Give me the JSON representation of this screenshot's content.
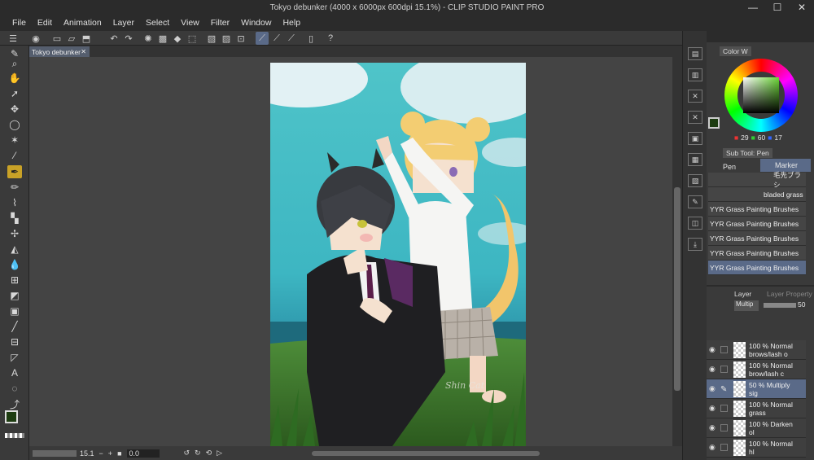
{
  "window": {
    "title": "Tokyo debunker (4000 x 6000px 600dpi 15.1%)  - CLIP STUDIO PAINT PRO",
    "minimize": "—",
    "maximize": "☐",
    "close": "✕"
  },
  "menu": [
    "File",
    "Edit",
    "Animation",
    "Layer",
    "Select",
    "View",
    "Filter",
    "Window",
    "Help"
  ],
  "document_tab": {
    "label": "Tokyo debunker",
    "close": "✕"
  },
  "status": {
    "zoom": "15.1",
    "rotation": "0.0"
  },
  "color_panel": {
    "tab": "Color W",
    "r": "29",
    "g": "60",
    "b": "17",
    "colors": {
      "main": "#1d3c11",
      "hue_marker": "#9ed65a"
    }
  },
  "subtool_panel": {
    "tab": "Sub Tool: Pen",
    "groups": [
      "Pen",
      "Marker"
    ],
    "brushes": [
      "毛先ブラシ",
      "bladed grass",
      "YYR Grass Painting Brushes",
      "YYR Grass Painting Brushes",
      "YYR Grass Painting Brushes",
      "YYR Grass Painting Brushes",
      "YYR Grass Painting Brushes"
    ]
  },
  "layer_panel": {
    "tabs": [
      "Layer",
      "Layer Property"
    ],
    "blend_mode": "Multip",
    "opacity": "50",
    "layers": [
      {
        "line1": "100 % Normal",
        "line2": "brows/lash o",
        "selected": false
      },
      {
        "line1": "100 % Normal",
        "line2": "brow/lash c",
        "selected": false
      },
      {
        "line1": "50 % Multiply",
        "line2": "sig",
        "selected": true
      },
      {
        "line1": "100 % Normal",
        "line2": "grass",
        "selected": false
      },
      {
        "line1": "100 % Darken",
        "line2": "ol",
        "selected": false
      },
      {
        "line1": "100 % Normal",
        "line2": "hl",
        "selected": false
      }
    ]
  },
  "artwork": {
    "signature": "Shin Cat"
  },
  "icons": {
    "tools": [
      "zoom-icon",
      "hand-icon",
      "object-select-icon",
      "move-icon",
      "lasso-icon",
      "magic-wand-icon",
      "eyedropper-icon",
      "pen-icon",
      "pencil-icon",
      "brush-icon",
      "airbrush-icon",
      "decoration-icon",
      "eraser-icon",
      "blend-icon",
      "fill-icon",
      "gradient-icon",
      "figure-icon",
      "frame-icon",
      "ruler-icon",
      "text-icon",
      "balloon-icon",
      "correct-line-icon",
      "operation-icon"
    ]
  }
}
